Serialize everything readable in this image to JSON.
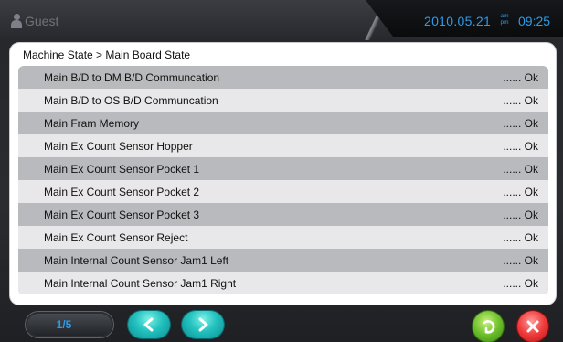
{
  "header": {
    "user_name": "Guest",
    "date": "2010.05.21",
    "am_label": "am",
    "pm_label": "pm",
    "time": "09:25"
  },
  "panel": {
    "breadcrumb": "Machine State > Main Board State",
    "rows": [
      {
        "label": "Main B/D to DM B/D Communcation",
        "value": "...... Ok"
      },
      {
        "label": "Main B/D to OS B/D Communcation",
        "value": "...... Ok"
      },
      {
        "label": "Main Fram Memory",
        "value": "...... Ok"
      },
      {
        "label": "Main Ex Count Sensor Hopper",
        "value": "...... Ok"
      },
      {
        "label": "Main Ex Count Sensor Pocket 1",
        "value": "...... Ok"
      },
      {
        "label": "Main Ex Count Sensor Pocket 2",
        "value": "...... Ok"
      },
      {
        "label": "Main Ex Count Sensor Pocket 3",
        "value": "...... Ok"
      },
      {
        "label": "Main Ex Count Sensor Reject",
        "value": "...... Ok"
      },
      {
        "label": "Main Internal Count Sensor Jam1 Left",
        "value": "...... Ok"
      },
      {
        "label": "Main Internal Count Sensor Jam1 Right",
        "value": "...... Ok"
      }
    ]
  },
  "footer": {
    "page_indicator": "1/5",
    "icons": {
      "prev": "chevron-left-icon",
      "next": "chevron-right-icon",
      "confirm": "return-arrow-icon",
      "close": "close-icon"
    }
  },
  "colors": {
    "accent": "#2f9be6",
    "row_dark": "#b9babd",
    "row_light": "#e8e8ea",
    "nav_button": "#23c2bf",
    "confirm_button": "#6cbf2a",
    "close_button": "#f03a3a"
  }
}
